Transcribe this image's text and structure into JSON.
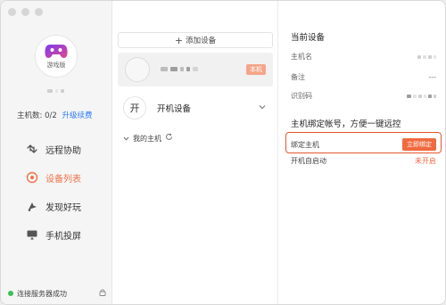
{
  "sidebar": {
    "avatar_caption": "游戏版",
    "host_count_label": "主机数: 0/2",
    "upgrade_link": "升级续费",
    "nav": [
      {
        "label": "远程协助",
        "icon": "remote-assist-icon",
        "active": false
      },
      {
        "label": "设备列表",
        "icon": "device-list-icon",
        "active": true
      },
      {
        "label": "发现好玩",
        "icon": "discover-icon",
        "active": false
      },
      {
        "label": "手机投屏",
        "icon": "screen-cast-icon",
        "active": false
      }
    ],
    "status_text": "连接服务器成功"
  },
  "middle": {
    "add_device_label": "添加设备",
    "local_badge": "本机",
    "boot_avatar_char": "开",
    "boot_device_label": "开机设备",
    "my_hosts_label": "我的主机"
  },
  "right": {
    "current_device_title": "当前设备",
    "hostname_label": "主机名",
    "note_label": "备注",
    "note_value": "---",
    "id_label": "识别码",
    "bind_title": "主机绑定帐号，方便一键远控",
    "bind_host_label": "绑定主机",
    "bind_now_button": "立即绑定",
    "autostart_label": "开机自启动",
    "autostart_value": "未开启"
  },
  "colors": {
    "accent": "#f0714a",
    "link": "#2f7cf6",
    "status_ok": "#3cc05a",
    "highlight_border": "#e8552f"
  }
}
